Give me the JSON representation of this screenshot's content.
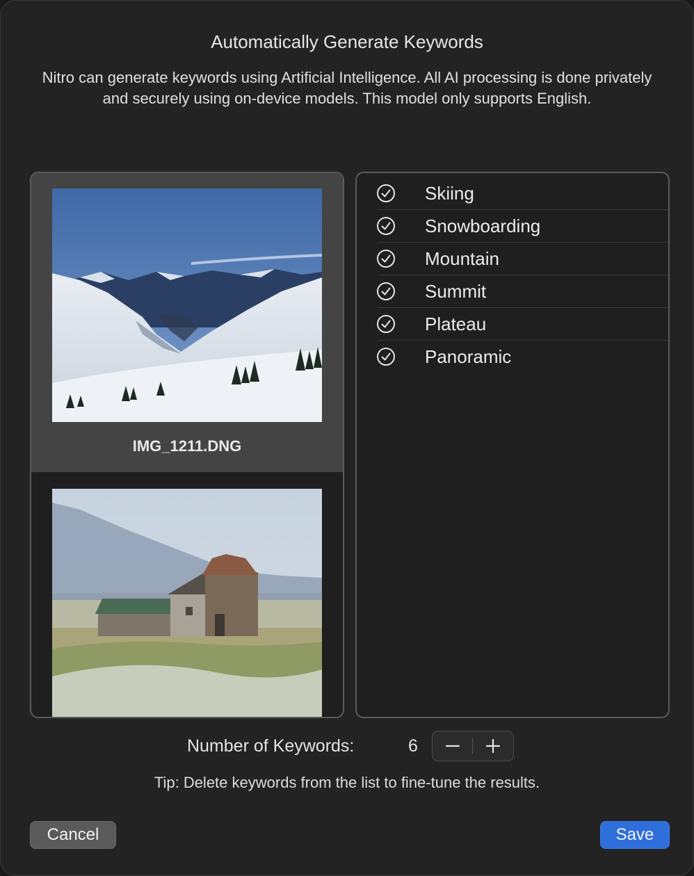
{
  "dialog": {
    "title": "Automatically Generate Keywords",
    "description": "Nitro can generate keywords using Artificial Intelligence. All AI processing is done privately and securely using on-device models. This model only supports English."
  },
  "photos": [
    {
      "filename": "IMG_1211.DNG",
      "selected": true
    },
    {
      "selected": false
    }
  ],
  "keywords": [
    {
      "label": "Skiing",
      "icon": "checkmark-circle-icon"
    },
    {
      "label": "Snowboarding",
      "icon": "checkmark-circle-icon"
    },
    {
      "label": "Mountain",
      "icon": "checkmark-circle-icon"
    },
    {
      "label": "Summit",
      "icon": "checkmark-circle-icon"
    },
    {
      "label": "Plateau",
      "icon": "checkmark-circle-icon"
    },
    {
      "label": "Panoramic",
      "icon": "checkmark-circle-icon"
    }
  ],
  "keyword_count": {
    "label": "Number of Keywords:",
    "value": "6",
    "decrement_icon": "minus-icon",
    "increment_icon": "plus-icon"
  },
  "tip": "Tip: Delete keywords from the list to fine-tune the results.",
  "buttons": {
    "cancel": "Cancel",
    "save": "Save"
  },
  "colors": {
    "background": "#232323",
    "selected_row": "#444444",
    "accent": "#2f6fdc"
  }
}
